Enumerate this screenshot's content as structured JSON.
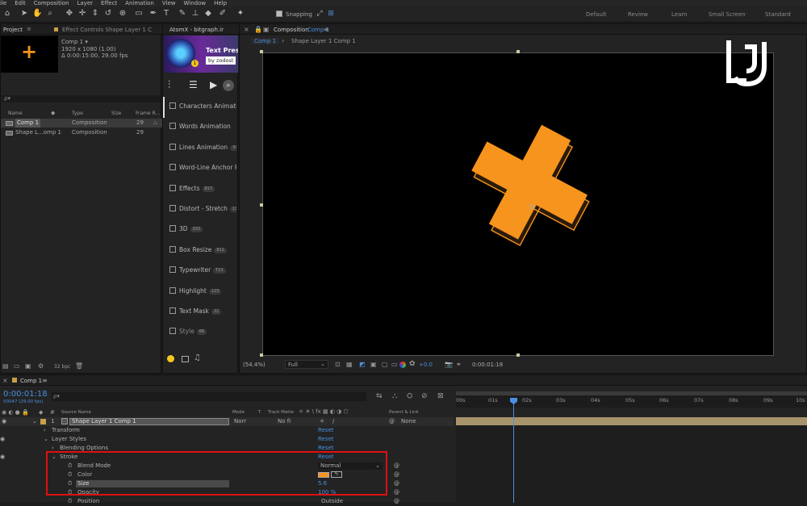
{
  "menu": [
    "ile",
    "Edit",
    "Composition",
    "Layer",
    "Effect",
    "Animation",
    "View",
    "Window",
    "Help"
  ],
  "toolbar": {
    "snapping_label": "Snapping",
    "workspaces": [
      "Default",
      "Review",
      "Learn",
      "Small Screen",
      "Standard"
    ]
  },
  "project": {
    "tab": "Project",
    "effect_tab": "Effect Controls Shape Layer 1 C",
    "comp_name": "Comp 1 ▾",
    "comp_res": "1920 x 1080 (1.00)",
    "comp_dur": "Δ 0:00:15:00, 29.00 fps",
    "search_placeholder": "ρ▾",
    "columns": {
      "name": "Name",
      "type": "Type",
      "size": "Size",
      "fr": "Frame R..."
    },
    "items": [
      {
        "name": "Comp 1",
        "type": "Composition",
        "fr": "29"
      },
      {
        "name": "Shape L...omp 1",
        "type": "Composition",
        "fr": "29"
      }
    ],
    "bpc": "32 bpc"
  },
  "atomx": {
    "tab": "AtomX - bitgraph.ir",
    "banner_title": "Text Pres",
    "banner_by": "by zodost",
    "banner_num": "1",
    "items": [
      {
        "label": "Characters Animati",
        "badge": ""
      },
      {
        "label": "Words Animation",
        "badge": ""
      },
      {
        "label": "Lines Animation",
        "badge": "34"
      },
      {
        "label": "Word-Line Anchor P",
        "badge": ""
      },
      {
        "label": "Effects",
        "badge": "817"
      },
      {
        "label": "Distort - Stretch",
        "badge": "13"
      },
      {
        "label": "3D",
        "badge": "333"
      },
      {
        "label": "Box Resize",
        "badge": "811"
      },
      {
        "label": "Typewriter",
        "badge": "T13"
      },
      {
        "label": "Highlight",
        "badge": "123"
      },
      {
        "label": "Text Mask",
        "badge": "22"
      },
      {
        "label": "Style",
        "badge": "68"
      }
    ]
  },
  "comp": {
    "tab_prefix": "Composition",
    "tab_name": "Comp 1",
    "sub_tab": "Comp 1",
    "sub_tab2": "Shape Layer 1 Comp 1",
    "zoom": "(54.4%)",
    "quality": "Full",
    "exposure": "+0.0",
    "timecode": "0:00:01:18"
  },
  "timeline": {
    "tab": "Comp 1",
    "timecode": "0:00:01:18",
    "frames": "00047 (29.00 fps)",
    "search_placeholder": "ρ▾",
    "columns": {
      "source": "Source Name",
      "mode": "Mode",
      "t": "T",
      "matte": "Track Matte",
      "parent": "Parent & Link"
    },
    "layer": {
      "num": "1",
      "name": "Shape Layer 1 Comp 1",
      "mode": "Norr",
      "matte": "No fi",
      "parent": "None"
    },
    "ruler": [
      "00s",
      "01s",
      "02s",
      "03s",
      "04s",
      "05s",
      "06s",
      "07s",
      "08s",
      "09s",
      "10s"
    ],
    "props": {
      "transform": "Transform",
      "layer_styles": "Layer Styles",
      "blending": "Blending Options",
      "stroke": "Stroke",
      "blend_mode": "Blend Mode",
      "blend_mode_val": "Normal",
      "color": "Color",
      "size": "Size",
      "size_val": "5.6",
      "opacity": "Opacity",
      "opacity_val": "100 %",
      "position": "Position",
      "position_val": "Outside",
      "reset": "Reset"
    }
  },
  "colors": {
    "accent": "#4a8fe0",
    "shape": "#f7941d",
    "highlight": "#e01010"
  }
}
